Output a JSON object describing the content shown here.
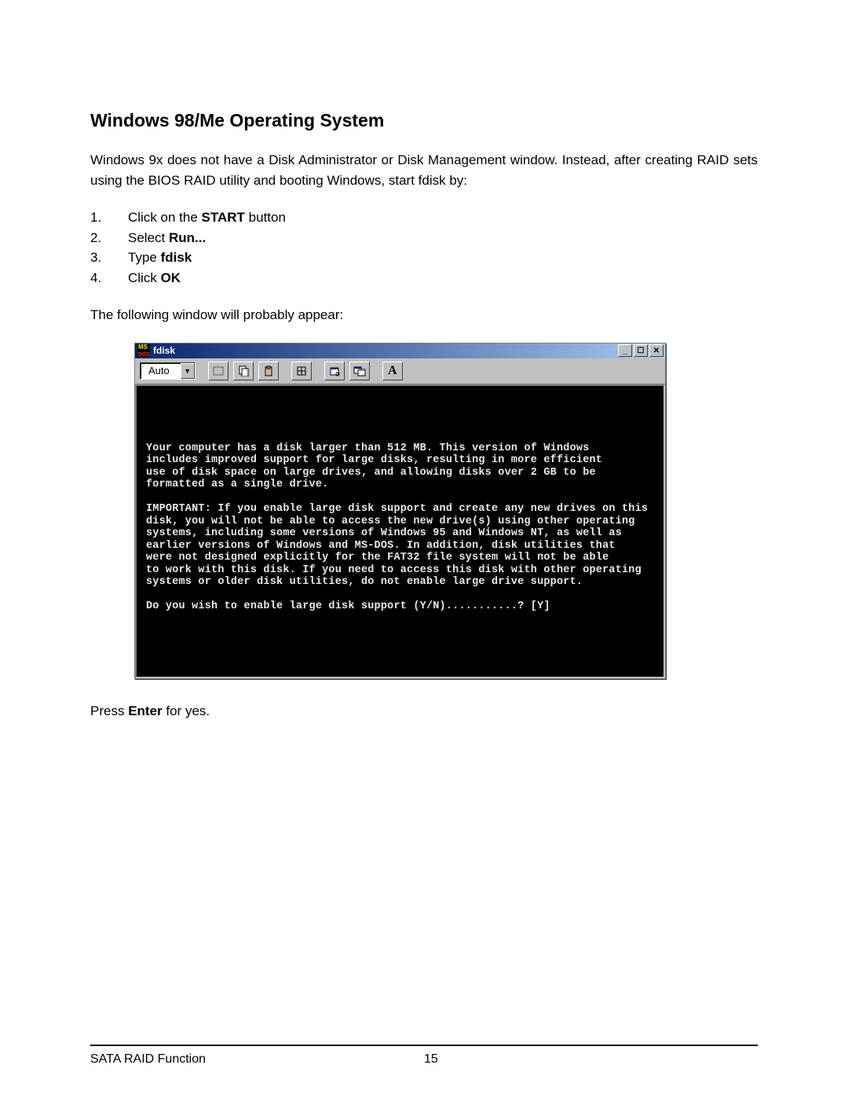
{
  "heading": "Windows 98/Me Operating System",
  "intro": "Windows 9x does not have a Disk Administrator or Disk Management window. Instead, after creating RAID sets using the BIOS RAID utility and booting Windows, start fdisk by:",
  "steps": [
    {
      "num": "1.",
      "pre": "Click on the ",
      "bold": "START",
      "post": " button"
    },
    {
      "num": "2.",
      "pre": "Select ",
      "bold": "Run...",
      "post": ""
    },
    {
      "num": "3.",
      "pre": "Type ",
      "bold": "fdisk",
      "post": ""
    },
    {
      "num": "4.",
      "pre": "Click ",
      "bold": "OK",
      "post": ""
    }
  ],
  "pre_window_text": "The following window will probably appear:",
  "window": {
    "title": "fdisk",
    "toolbar": {
      "combo_value": "Auto",
      "buttons": [
        "select-icon",
        "copy-icon",
        "paste-icon",
        "fullscreen-icon",
        "properties-icon",
        "background-icon",
        "font-icon"
      ]
    },
    "terminal_lines": [
      "",
      "",
      "",
      "",
      "Your computer has a disk larger than 512 MB. This version of Windows",
      "includes improved support for large disks, resulting in more efficient",
      "use of disk space on large drives, and allowing disks over 2 GB to be",
      "formatted as a single drive.",
      "",
      "IMPORTANT: If you enable large disk support and create any new drives on this",
      "disk, you will not be able to access the new drive(s) using other operating",
      "systems, including some versions of Windows 95 and Windows NT, as well as",
      "earlier versions of Windows and MS-DOS. In addition, disk utilities that",
      "were not designed explicitly for the FAT32 file system will not be able",
      "to work with this disk. If you need to access this disk with other operating",
      "systems or older disk utilities, do not enable large drive support.",
      "",
      "Do you wish to enable large disk support (Y/N)...........? [Y]"
    ]
  },
  "post_window": {
    "pre": "Press ",
    "bold": "Enter",
    "post": " for yes."
  },
  "footer": {
    "left": "SATA RAID Function",
    "page": "15"
  }
}
